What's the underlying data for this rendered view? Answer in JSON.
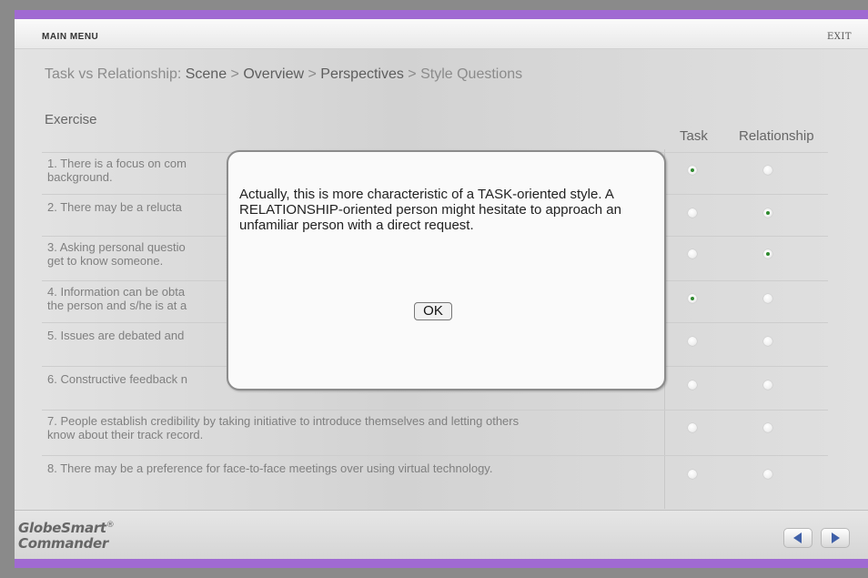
{
  "header": {
    "main_menu": "MAIN MENU",
    "exit": "EXIT"
  },
  "breadcrumb": {
    "prefix": "Task vs Relationship: ",
    "items": [
      "Scene",
      "Overview",
      "Perspectives",
      "Style Questions"
    ],
    "separator": " > "
  },
  "exercise": {
    "title": "Exercise",
    "columns": [
      "Task",
      "Relationship"
    ],
    "questions": [
      {
        "text": "1. There is a focus on com\nbackground.",
        "task": true,
        "relationship": false
      },
      {
        "text": "2. There may be a relucta",
        "task": false,
        "relationship": true
      },
      {
        "text": "3. Asking personal questio\nget to know someone.",
        "task": false,
        "relationship": true
      },
      {
        "text": "4. Information can be obta\nthe person and s/he is at a",
        "task": true,
        "relationship": false
      },
      {
        "text": "5. Issues are debated and",
        "task": false,
        "relationship": false
      },
      {
        "text": "6. Constructive feedback n",
        "task": false,
        "relationship": false
      },
      {
        "text": "7. People establish credibility by taking initiative to introduce themselves and letting others\nknow about their track record.",
        "task": false,
        "relationship": false
      },
      {
        "text": "8. There may be a preference for face-to-face meetings over using virtual technology.",
        "task": false,
        "relationship": false
      }
    ]
  },
  "dialog": {
    "message": "Actually, this is more characteristic of a TASK-oriented style. A RELATIONSHIP-oriented person might hesitate to approach an unfamiliar person with a direct request.",
    "ok_label": "OK"
  },
  "footer": {
    "logo_line1": "GlobeSmart",
    "logo_reg": "®",
    "logo_line2": "Commander"
  },
  "icons": {
    "prev": "arrow-left-icon",
    "next": "arrow-right-icon"
  },
  "colors": {
    "accent": "#a06ad2",
    "nav_arrow": "#3f60a8",
    "radio_selected": "#2f8a2f"
  }
}
